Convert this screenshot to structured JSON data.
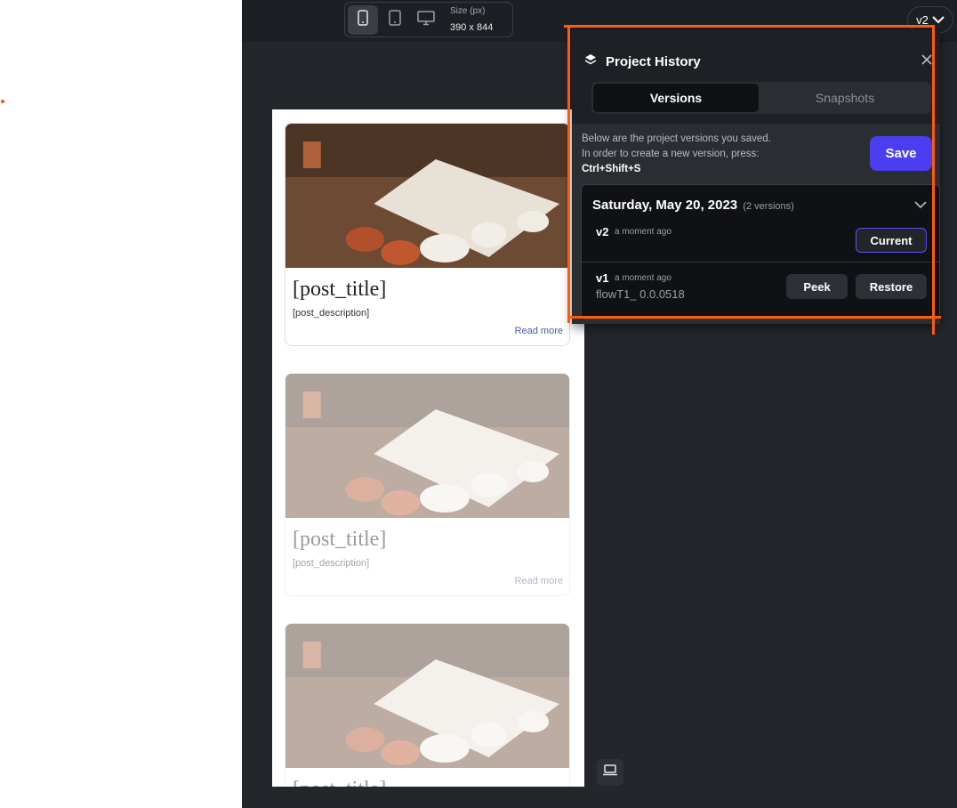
{
  "toolbar": {
    "size_label": "Size (px)",
    "size_value": "390 x 844",
    "devices": [
      "mobile-icon",
      "tablet-icon",
      "desktop-icon"
    ],
    "active_device": "mobile"
  },
  "version_selector": {
    "label": "v2"
  },
  "preview": {
    "posts": [
      {
        "title": "[post_title]",
        "description": "[post_description]",
        "read_more": "Read more"
      },
      {
        "title": "[post_title]",
        "description": "[post_description]",
        "read_more": "Read more"
      },
      {
        "title": "[post_title]"
      }
    ]
  },
  "history_panel": {
    "title": "Project History",
    "tabs": [
      {
        "label": "Versions",
        "active": true
      },
      {
        "label": "Snapshots",
        "active": false
      }
    ],
    "info_line1": "Below are the project versions you saved.",
    "info_line2": "In order to create a new version, press:",
    "shortcut": "Ctrl+Shift+S",
    "save_label": "Save",
    "group": {
      "date": "Saturday, May 20, 2023",
      "count": "(2 versions)",
      "versions": [
        {
          "name": "v2",
          "time": "a moment ago",
          "file": "",
          "action": "Current"
        },
        {
          "name": "v1",
          "time": "a moment ago",
          "file": "flowT1_ 0.0.0518",
          "peek": "Peek",
          "restore": "Restore"
        }
      ]
    }
  },
  "colors": {
    "accent": "#4a3ef0",
    "highlight": "#ff5a0a",
    "panel_bg": "#1d2024"
  }
}
